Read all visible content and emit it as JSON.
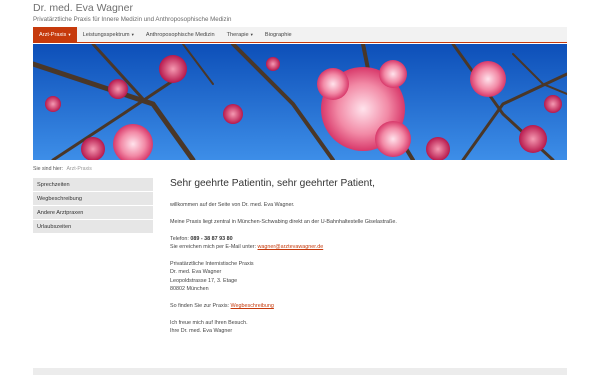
{
  "header": {
    "title": "Dr. med. Eva Wagner",
    "subtitle": "Privatärztliche Praxis für Innere Medizin und Anthroposophische Medizin"
  },
  "nav": {
    "items": [
      {
        "label": "Arzt-Praxis",
        "caret": "▾",
        "active": true
      },
      {
        "label": "Leistungsspektrum",
        "caret": "▾",
        "active": false
      },
      {
        "label": "Anthroposophische Medizin",
        "caret": "",
        "active": false
      },
      {
        "label": "Therapie",
        "caret": "▾",
        "active": false
      },
      {
        "label": "Biographie",
        "caret": "",
        "active": false
      }
    ]
  },
  "breadcrumb": {
    "prefix": "Sie sind hier:",
    "current": "Arzt-Praxis"
  },
  "sidebar": {
    "items": [
      "Sprechzeiten",
      "Wegbeschreibung",
      "Andere Arztpraxen",
      "Urlaubszeiten"
    ]
  },
  "main": {
    "heading": "Sehr geehrte Patientin, sehr geehrter Patient,",
    "welcome": "willkommen auf der Seite von Dr. med. Eva Wagner.",
    "location": "Meine Praxis liegt zentral in München-Schwabing direkt an der U-Bahnhaltestelle Giselastraße.",
    "phone_label": "Telefon:",
    "phone": "089 - 38 87 93 80",
    "email_prefix": "Sie erreichen mich per E-Mail unter:",
    "email": "wagner@arztevawagner.de",
    "address": [
      "Privatärztliche Internistische Praxis",
      "Dr. med. Eva Wagner",
      "Leopoldstrasse 17, 3. Etage",
      "80802 München"
    ],
    "directions_prefix": "So finden Sie zur Praxis:",
    "directions_link": "Wegbeschreibung",
    "closing": [
      "Ich freue mich auf Ihren Besuch.",
      "Ihre Dr. med. Eva Wagner"
    ]
  },
  "colors": {
    "accent": "#c63a0c",
    "sky": "#1f6fd0",
    "blossom": "#ef6f8f"
  }
}
